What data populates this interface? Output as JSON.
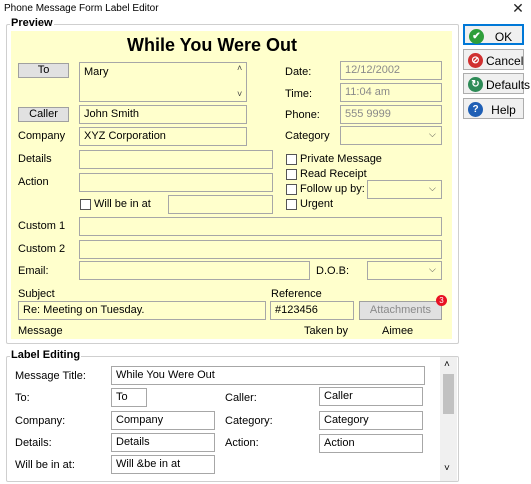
{
  "window": {
    "title": "Phone Message Form Label Editor",
    "close_glyph": "✕"
  },
  "preview": {
    "group_label": "Preview",
    "heading": "While You Were Out",
    "to_button": "To",
    "to_value": "Mary",
    "caller_button": "Caller",
    "caller_value": "John Smith",
    "company_label": "Company",
    "company_value": "XYZ Corporation",
    "details_label": "Details",
    "action_label": "Action",
    "will_be_in_label": "Will be in at",
    "date_label": "Date:",
    "date_value": "12/12/2002",
    "time_label": "Time:",
    "time_value": "11:04 am",
    "phone_label": "Phone:",
    "phone_value": "555 9999",
    "category_label": "Category",
    "private_label": "Private Message",
    "read_receipt_label": "Read Receipt",
    "follow_up_label": "Follow up by:",
    "urgent_label": "Urgent",
    "custom1_label": "Custom 1",
    "custom2_label": "Custom 2",
    "email_label": "Email:",
    "dob_label": "D.O.B:",
    "subject_label": "Subject",
    "subject_value": "Re: Meeting on Tuesday.",
    "reference_label": "Reference",
    "reference_value": "#123456",
    "attachments_label": "Attachments",
    "attachments_count": "3",
    "message_label": "Message",
    "taken_by_label": "Taken by",
    "taken_by_value": "Aimee",
    "scroll_up": "˄",
    "scroll_down": "˅",
    "dropdown": "⌵"
  },
  "buttons": {
    "ok": "OK",
    "cancel": "Cancel",
    "defaults": "Defaults",
    "help": "Help",
    "ok_icon": "✔",
    "cancel_icon": "⊘",
    "defaults_icon": "↻",
    "help_icon": "?"
  },
  "label_editing": {
    "group_label": "Label Editing",
    "message_title_label": "Message Title:",
    "message_title_value": "While You Were Out",
    "to_label": "To:",
    "to_value": "To",
    "caller_label": "Caller:",
    "caller_value": "Caller",
    "company_label": "Company:",
    "company_value": "Company",
    "category_label": "Category:",
    "category_value": "Category",
    "details_label": "Details:",
    "details_value": "Details",
    "action_label": "Action:",
    "action_value": "Action",
    "will_be_in_label": "Will be in at:",
    "will_be_in_value": "Will &be in at"
  },
  "colors": {
    "preview_bg": "#ffffcc",
    "badge": "#e81123",
    "ok_icon": "#2e9e3a",
    "cancel_icon": "#d03030",
    "defaults_icon": "#2e8b57",
    "help_icon": "#1f5fb5"
  }
}
